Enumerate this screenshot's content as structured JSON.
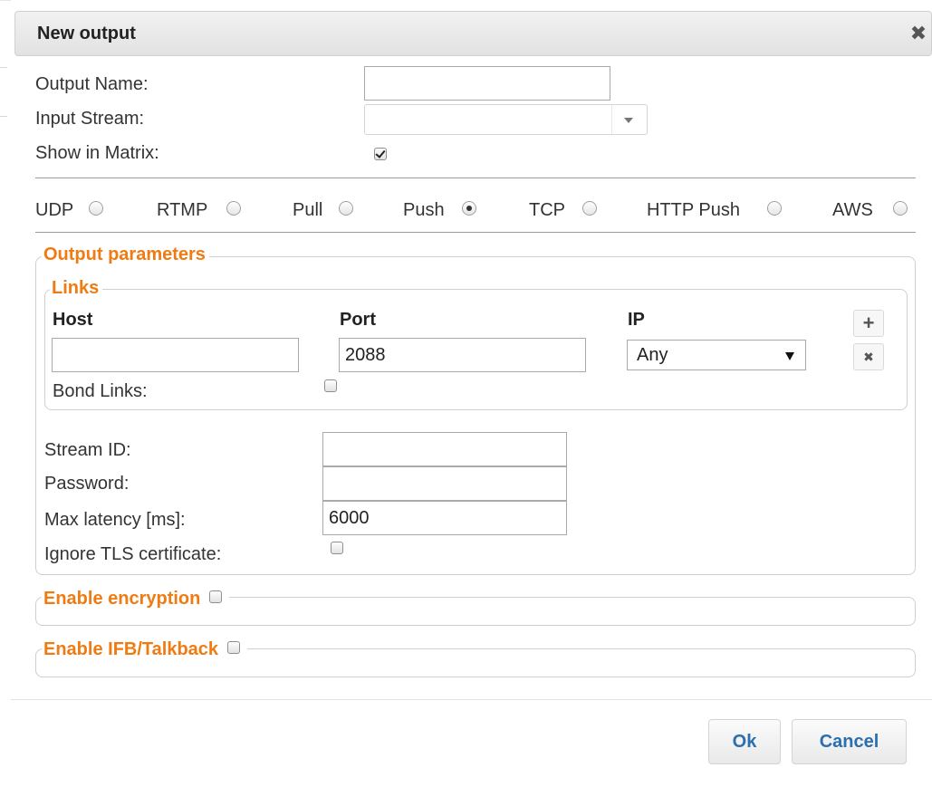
{
  "dialog": {
    "title": "New output"
  },
  "form": {
    "output_name_label": "Output Name:",
    "output_name_value": "",
    "input_stream_label": "Input Stream:",
    "input_stream_value": "",
    "show_in_matrix_label": "Show in Matrix:",
    "show_in_matrix_checked": true
  },
  "protocols": [
    {
      "label": "UDP",
      "selected": false
    },
    {
      "label": "RTMP",
      "selected": false
    },
    {
      "label": "Pull",
      "selected": false
    },
    {
      "label": "Push",
      "selected": true
    },
    {
      "label": "TCP",
      "selected": false
    },
    {
      "label": "HTTP Push",
      "selected": false
    },
    {
      "label": "AWS",
      "selected": false
    }
  ],
  "output_parameters": {
    "legend": "Output parameters",
    "links": {
      "legend": "Links",
      "host_header": "Host",
      "port_header": "Port",
      "ip_header": "IP",
      "host_value": "",
      "port_value": "2088",
      "ip_value": "Any",
      "add_icon": "plus-icon",
      "remove_icon": "close-icon",
      "bond_links_label": "Bond Links:",
      "bond_links_checked": false
    },
    "stream_id_label": "Stream ID:",
    "stream_id_value": "",
    "password_label": "Password:",
    "password_value": "",
    "max_latency_label": "Max latency [ms]:",
    "max_latency_value": "6000",
    "ignore_tls_label": "Ignore TLS certificate:",
    "ignore_tls_checked": false
  },
  "encryption": {
    "legend": "Enable encryption",
    "checked": false
  },
  "ifb": {
    "legend": "Enable IFB/Talkback",
    "checked": false
  },
  "footer": {
    "ok_label": "Ok",
    "cancel_label": "Cancel"
  },
  "colors": {
    "accent": "#f07b12",
    "button_text": "#2a6fae"
  }
}
